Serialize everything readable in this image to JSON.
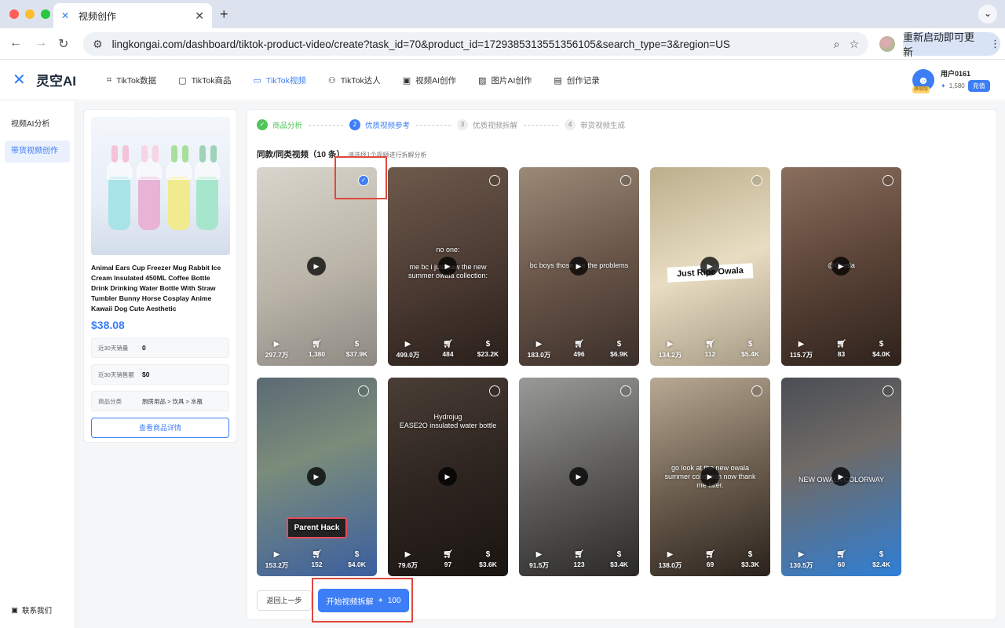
{
  "browser": {
    "tab_title": "视频创作",
    "url": "lingkongai.com/dashboard/tiktok-product-video/create?task_id=70&product_id=1729385313551356105&search_type=3&region=US",
    "update_label": "重新启动即可更新"
  },
  "header": {
    "logo_text": "灵空AI",
    "nav": [
      {
        "label": "TikTok数据",
        "icon": "chart-icon"
      },
      {
        "label": "TikTok商品",
        "icon": "bag-icon"
      },
      {
        "label": "TikTok视频",
        "icon": "video-icon",
        "active": true
      },
      {
        "label": "TikTok达人",
        "icon": "users-icon"
      },
      {
        "label": "视频AI创作",
        "icon": "film-icon"
      },
      {
        "label": "图片AI创作",
        "icon": "image-icon"
      },
      {
        "label": "创作记录",
        "icon": "folder-icon"
      }
    ],
    "user": {
      "name": "用户0161",
      "badge": "旗舰版",
      "credits": "1,580",
      "recharge_label": "充值"
    }
  },
  "sidebar": {
    "items": [
      {
        "label": "视频AI分析",
        "active": false
      },
      {
        "label": "带货视频创作",
        "active": true
      }
    ],
    "contact_label": "联系我们"
  },
  "product": {
    "title": "Animal Ears Cup Freezer Mug Rabbit Ice Cream Insulated 450ML Coffee Bottle Drink Drinking Water Bottle With Straw Tumbler Bunny Horse Cosplay Anime Kawaii Dog Cute Aesthetic",
    "price": "$38.08",
    "stats": [
      {
        "label": "近30天销量",
        "value": "0"
      },
      {
        "label": "近30天销售额",
        "value": "$0"
      },
      {
        "label": "商品分类",
        "value": "厨房用品 > 饮具 > 水瓶"
      }
    ],
    "detail_button": "查看商品详情"
  },
  "steps": [
    {
      "num": "1",
      "label": "商品分析",
      "state": "done"
    },
    {
      "num": "2",
      "label": "优质视频参考",
      "state": "current"
    },
    {
      "num": "3",
      "label": "优质视频拆解",
      "state": "todo"
    },
    {
      "num": "4",
      "label": "带货视频生成",
      "state": "todo"
    }
  ],
  "list": {
    "title": "同款/同类视频（10 条）",
    "hint": "请选择1个视频进行拆解分析"
  },
  "videos": [
    {
      "views": "297.7万",
      "sales": "1,380",
      "revenue": "$37.9K",
      "selected": true,
      "caption": "",
      "bg": "linear-gradient(160deg,#d9d5cc,#b9b3a8 55%,#8e8a83)"
    },
    {
      "views": "499.0万",
      "sales": "484",
      "revenue": "$23.2K",
      "selected": false,
      "caption": "no one:\n\nme bc i just saw the new summer owala collection:",
      "bg": "linear-gradient(160deg,#6e5a4c,#4a3a32 55%,#2a1f1a)"
    },
    {
      "views": "183.0万",
      "sales": "496",
      "revenue": "$6.9K",
      "selected": false,
      "caption": "bc boys those are the problems",
      "bg": "linear-gradient(160deg,#9b8a78,#6a5649 50%,#3b2f2a)"
    },
    {
      "views": "134.2万",
      "sales": "112",
      "revenue": "$5.4K",
      "selected": false,
      "caption": "Just Ripe Owala",
      "box": true,
      "bg": "linear-gradient(160deg,#bcae8c,#e8ddc2 50%,#a69a85)"
    },
    {
      "views": "115.7万",
      "sales": "83",
      "revenue": "$4.0K",
      "selected": false,
      "caption": "@Owala",
      "bg": "linear-gradient(160deg,#8a6f5e,#5a4437 50%,#2e221c)"
    },
    {
      "views": "153.2万",
      "sales": "152",
      "revenue": "$4.0K",
      "selected": false,
      "caption": "Parent Hack",
      "dark": true,
      "bg": "linear-gradient(160deg,#5b6a74,#7b8c7a 40%,#3b5fa0)"
    },
    {
      "views": "79.6万",
      "sales": "97",
      "revenue": "$3.6K",
      "selected": false,
      "caption": "Hydrojug\nEASE2O insulated water bottle",
      "bg": "linear-gradient(160deg,#4a3e36,#2e2520 50%,#1a1512)"
    },
    {
      "views": "91.5万",
      "sales": "123",
      "revenue": "$3.4K",
      "selected": false,
      "caption": "",
      "bg": "linear-gradient(160deg,#9a9a98,#5e5d5b 50%,#2a2928)"
    },
    {
      "views": "138.0万",
      "sales": "69",
      "revenue": "$3.3K",
      "selected": false,
      "caption": "go look at the new owala summer collection now thank me later.",
      "bg": "linear-gradient(160deg,#b8a994,#6e6050 50%,#2a221c)"
    },
    {
      "views": "130.5万",
      "sales": "60",
      "revenue": "$2.4K",
      "selected": false,
      "caption": "NEW OWALA COLORWAY",
      "bg": "linear-gradient(160deg,#4a4e55,#6f6a66 40%,#2f7fd6)"
    }
  ],
  "actions": {
    "back_label": "返回上一步",
    "start_label": "开始视频拆解",
    "cost": "100"
  }
}
